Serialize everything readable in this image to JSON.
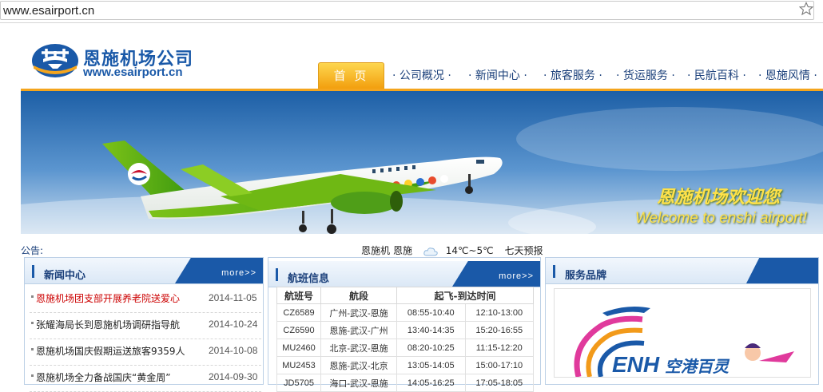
{
  "browser": {
    "url": "www.esairport.cn"
  },
  "header": {
    "logo_name": "恩施机场公司",
    "logo_url": "www.esairport.cn",
    "nav": [
      {
        "label": "首 页",
        "active": true
      },
      {
        "label": "· 公司概况 ·"
      },
      {
        "label": "· 新闻中心 ·"
      },
      {
        "label": "· 旅客服务 ·"
      },
      {
        "label": "· 货运服务 ·"
      },
      {
        "label": "· 民航百科 ·"
      },
      {
        "label": "· 恩施风情 ·"
      }
    ]
  },
  "banner": {
    "caption_cn": "恩施机场欢迎您",
    "caption_en": "Welcome to enshi airport!"
  },
  "notice": {
    "label": "公告:",
    "weather_city_prefix": "恩施机",
    "weather_city": "恩施",
    "weather_temp": "14℃~5℃",
    "weather_forecast": "七天预报"
  },
  "news": {
    "title": "新闻中心",
    "more": "more>>",
    "items": [
      {
        "title": "恩施机场团支部开展养老院送爱心",
        "date": "2014-11-05",
        "highlight": true
      },
      {
        "title": "张耀海局长到恩施机场调研指导航",
        "date": "2014-10-24"
      },
      {
        "title": "恩施机场国庆假期运送旅客9359人",
        "date": "2014-10-08"
      },
      {
        "title": "恩施机场全力备战国庆“黄金周”",
        "date": "2014-09-30"
      }
    ]
  },
  "flights": {
    "title": "航班信息",
    "more": "more>>",
    "headers": [
      "航班号",
      "航段",
      "起飞-到达时间"
    ],
    "rows": [
      {
        "no": "CZ6589",
        "route": "广州-武汉-恩施",
        "dep": "08:55-10:40",
        "arr": "12:10-13:00"
      },
      {
        "no": "CZ6590",
        "route": "恩施-武汉-广州",
        "dep": "13:40-14:35",
        "arr": "15:20-16:55"
      },
      {
        "no": "MU2460",
        "route": "北京-武汉-恩施",
        "dep": "08:20-10:25",
        "arr": "11:15-12:20"
      },
      {
        "no": "MU2453",
        "route": "恩施-武汉-北京",
        "dep": "13:05-14:05",
        "arr": "15:00-17:10"
      },
      {
        "no": "JD5705",
        "route": "海口-武汉-恩施",
        "dep": "14:05-16:25",
        "arr": "17:05-18:05"
      }
    ]
  },
  "brand": {
    "title": "服务品牌",
    "logo_text": "ENH",
    "slogan": "空港百灵"
  },
  "colors": {
    "accent": "#1a59a8",
    "orange": "#f4a51d",
    "highlight": "#cc0000"
  }
}
